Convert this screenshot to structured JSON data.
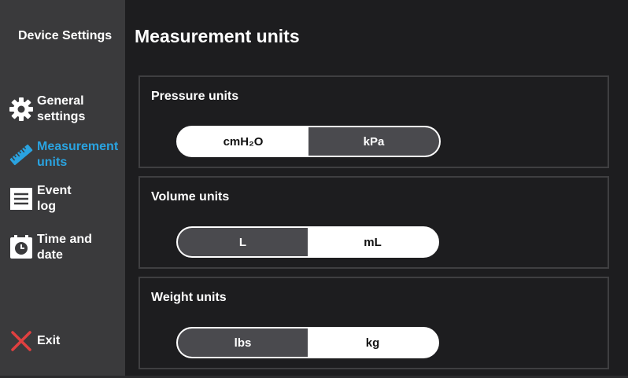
{
  "sidebar": {
    "title": "Device Settings",
    "items": [
      {
        "label": "General\nsettings",
        "icon": "gear-icon",
        "active": false
      },
      {
        "label": "Measurement\nunits",
        "icon": "ruler-icon",
        "active": true
      },
      {
        "label": "Event\nlog",
        "icon": "list-icon",
        "active": false
      },
      {
        "label": "Time and\ndate",
        "icon": "clock-icon",
        "active": false
      }
    ],
    "exit_label": "Exit",
    "exit_icon": "close-icon"
  },
  "main": {
    "title": "Measurement units",
    "sections": [
      {
        "label": "Pressure units",
        "options": [
          "cmH₂O",
          "kPa"
        ],
        "selected": "kPa"
      },
      {
        "label": "Volume units",
        "options": [
          "L",
          "mL"
        ],
        "selected": "L"
      },
      {
        "label": "Weight units",
        "options": [
          "lbs",
          "kg"
        ],
        "selected": "lbs"
      }
    ]
  },
  "colors": {
    "accent": "#2aa3e0",
    "exit": "#e04040",
    "sidebar_bg": "#3a3a3c",
    "main_bg": "#1d1d1f",
    "selected_segment": "#4a4a4e"
  }
}
